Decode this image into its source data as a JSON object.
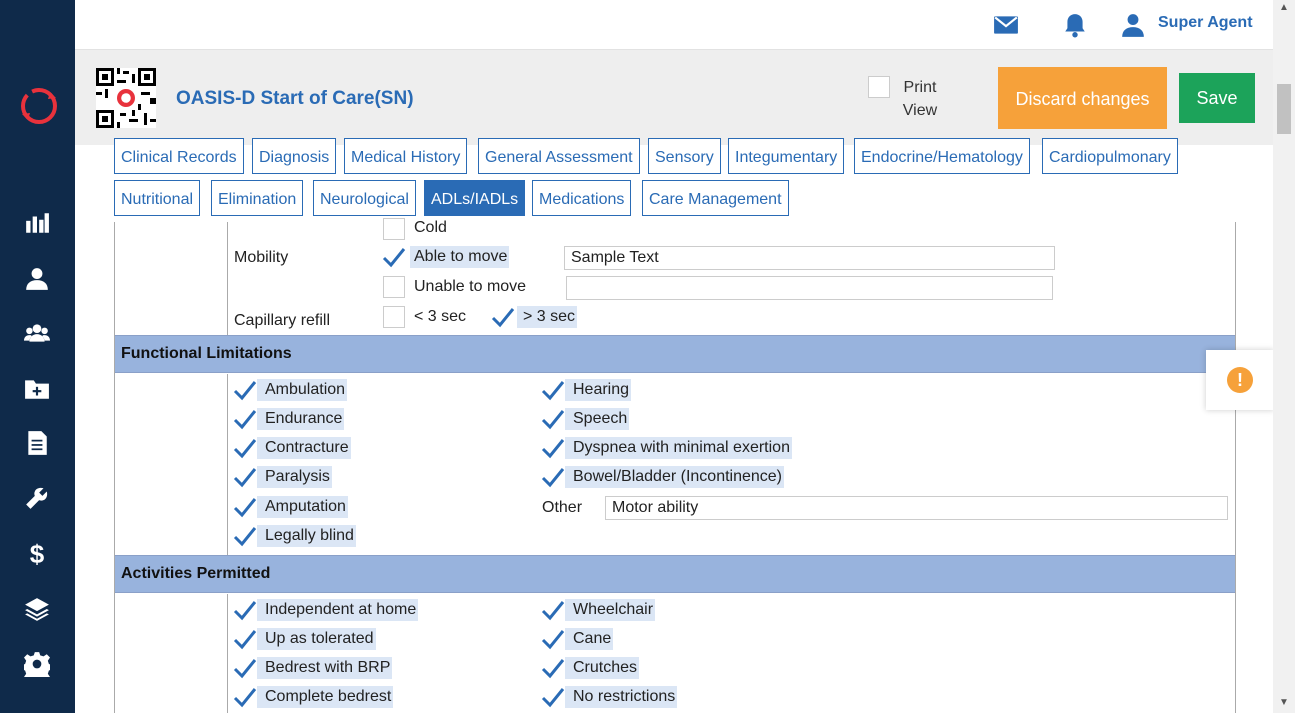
{
  "topbar": {
    "user_name": "Super Agent"
  },
  "header": {
    "title": "OASIS-D Start of Care(SN)",
    "print_view": "Print View",
    "discard": "Discard changes",
    "save": "Save"
  },
  "tabs": [
    "Clinical Records",
    "Diagnosis",
    "Medical History",
    "General Assessment",
    "Sensory",
    "Integumentary",
    "Endocrine/Hematology",
    "Cardiopulmonary",
    "Nutritional",
    "Elimination",
    "Neurological",
    "ADLs/IADLs",
    "Medications",
    "Care Management"
  ],
  "active_tab": "ADLs/IADLs",
  "circulation": {
    "cold_label": "Cold",
    "mobility_label": "Mobility",
    "able_to_move": "Able to move",
    "able_to_move_text": "Sample Text",
    "unable_to_move": "Unable to move",
    "unable_to_move_text": "",
    "capillary_label": "Capillary refill",
    "lt3": "< 3 sec",
    "gt3": "> 3 sec"
  },
  "functional": {
    "heading": "Functional Limitations",
    "left": [
      "Ambulation",
      "Endurance",
      "Contracture",
      "Paralysis",
      "Amputation",
      "Legally blind"
    ],
    "right": [
      "Hearing",
      "Speech",
      "Dyspnea with minimal exertion",
      "Bowel/Bladder (Incontinence)"
    ],
    "other_label": "Other",
    "other_value": "Motor ability"
  },
  "activities": {
    "heading": "Activities Permitted",
    "left": [
      "Independent at home",
      "Up as tolerated",
      "Bedrest with BRP",
      "Complete bedrest"
    ],
    "right": [
      "Wheelchair",
      "Cane",
      "Crutches",
      "No restrictions"
    ]
  },
  "alert_symbol": "!",
  "colors": {
    "sidebar": "#0f2a4a",
    "accent": "#2a6bb5",
    "discard": "#f6a13a",
    "save": "#1ca35a",
    "section": "#98b3dd"
  }
}
